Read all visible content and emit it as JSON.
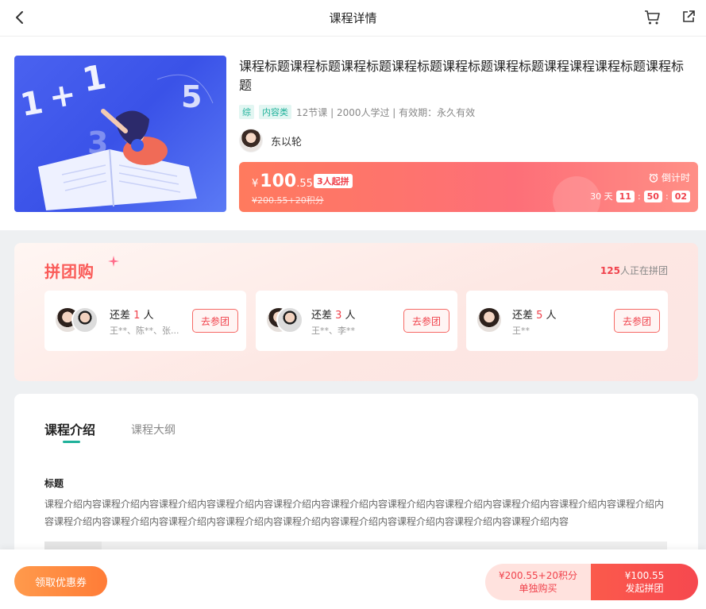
{
  "topbar": {
    "title": "课程详情",
    "back_icon": "back-arrow-icon",
    "cart_icon": "cart-icon",
    "share_icon": "share-icon"
  },
  "course": {
    "cover_digits": [
      "1",
      "+",
      "1",
      "5",
      "3"
    ],
    "title": "课程标题课程标题课程标题课程标题课程标题课程标题课程课程课程标题课程标题",
    "tags": [
      "综",
      "内容类"
    ],
    "meta": "12节课 | 2000人学过 | 有效期：永久有效",
    "teacher": "东以轮"
  },
  "price": {
    "currency": "¥",
    "integer": "100",
    "decimal": ".55",
    "group_badge": "3人起拼",
    "original": "¥200.55+20积分",
    "countdown_label": "倒计时",
    "days": "30 天",
    "hours": "11",
    "minutes": "50",
    "seconds": "02",
    "colors": {
      "accent": "#f0414b",
      "bar_start": "#ff7a5e",
      "bar_end": "#ff8f86"
    }
  },
  "group": {
    "title": "拼团购",
    "count_num": "125",
    "count_text": "人正在拼团",
    "join_label": "去参团",
    "cards": [
      {
        "need_prefix": "还差 ",
        "need_num": "1",
        "need_suffix": " 人",
        "names": "王**、陈**、张..."
      },
      {
        "need_prefix": "还差 ",
        "need_num": "3",
        "need_suffix": " 人",
        "names": "王**、李**"
      },
      {
        "need_prefix": "还差 ",
        "need_num": "5",
        "need_suffix": " 人",
        "names": "王**"
      }
    ]
  },
  "intro": {
    "tabs": [
      "课程介绍",
      "课程大纲"
    ],
    "heading": "标题",
    "body": "课程介绍内容课程介绍内容课程介绍内容课程介绍内容课程介绍内容课程介绍内容课程介绍内容课程介绍内容课程介绍内容课程介绍内容课程介绍内容课程介绍内容课程介绍内容课程介绍内容课程介绍内容课程介绍内容课程介绍内容课程介绍内容课程介绍内容课程介绍内容"
  },
  "bottom": {
    "coupon": "领取优惠券",
    "single_price": "¥200.55+20积分",
    "single_label": "单独购买",
    "group_price": "¥100.55",
    "group_label": "发起拼团"
  }
}
